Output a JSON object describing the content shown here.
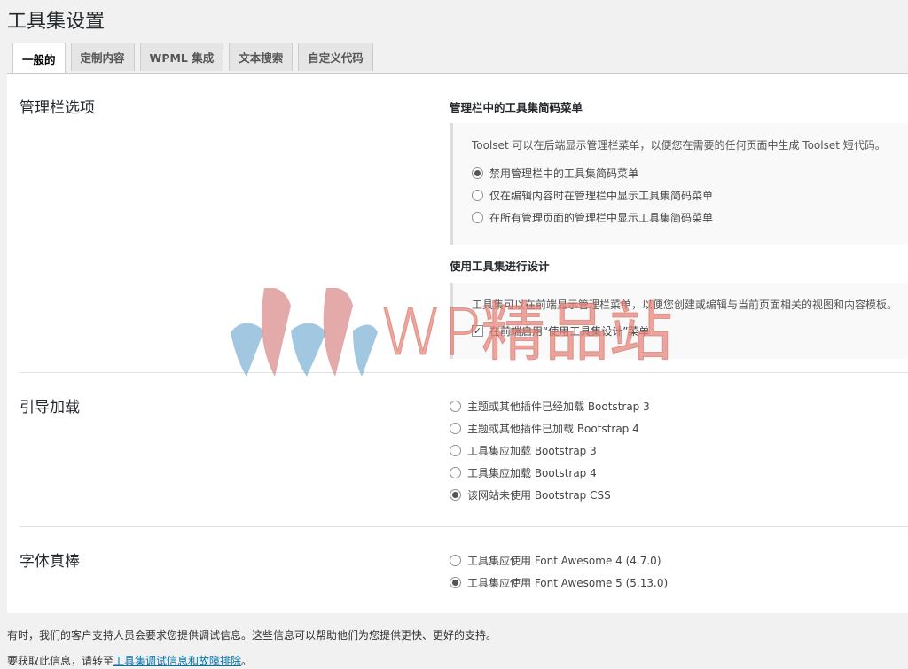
{
  "page": {
    "title": "工具集设置"
  },
  "tabs": [
    {
      "label": "一般的",
      "active": true
    },
    {
      "label": "定制内容",
      "active": false
    },
    {
      "label": "WPML 集成",
      "active": false
    },
    {
      "label": "文本搜索",
      "active": false
    },
    {
      "label": "自定义代码",
      "active": false
    }
  ],
  "admin_bar": {
    "title": "管理栏选项",
    "shortcode_menu": {
      "title": "管理栏中的工具集简码菜单",
      "description": "Toolset 可以在后端显示管理栏菜单，以便您在需要的任何页面中生成 Toolset 短代码。",
      "options": [
        {
          "label": "禁用管理栏中的工具集简码菜单",
          "checked": true
        },
        {
          "label": "仅在编辑内容时在管理栏中显示工具集简码菜单",
          "checked": false
        },
        {
          "label": "在所有管理页面的管理栏中显示工具集简码菜单",
          "checked": false
        }
      ]
    },
    "design": {
      "title": "使用工具集进行设计",
      "description": "工具集可以在前端显示管理栏菜单，以便您创建或编辑与当前页面相关的视图和内容模板。",
      "checkbox": {
        "label": "在前端启用“使用工具集设计”菜单",
        "checked": true
      }
    }
  },
  "bootstrap": {
    "title": "引导加载",
    "options": [
      {
        "label": "主题或其他插件已经加载 Bootstrap 3",
        "checked": false
      },
      {
        "label": "主题或其他插件已加载 Bootstrap 4",
        "checked": false
      },
      {
        "label": "工具集应加载 Bootstrap 3",
        "checked": false
      },
      {
        "label": "工具集应加载 Bootstrap 4",
        "checked": false
      },
      {
        "label": "该网站未使用 Bootstrap CSS",
        "checked": true
      }
    ]
  },
  "font_awesome": {
    "title": "字体真棒",
    "options": [
      {
        "label": "工具集应使用 Font Awesome 4 (4.7.0)",
        "checked": false
      },
      {
        "label": "工具集应使用 Font Awesome 5 (5.13.0)",
        "checked": true
      }
    ]
  },
  "footer": {
    "line1": "有时，我们的客户支持人员会要求您提供调试信息。这些信息可以帮助他们为您提供更快、更好的支持。",
    "line2_prefix": "要获取此信息，请转至",
    "line2_link": "工具集调试信息和故障排除",
    "line2_suffix": "。"
  },
  "watermark": {
    "text": "WP精品站"
  }
}
